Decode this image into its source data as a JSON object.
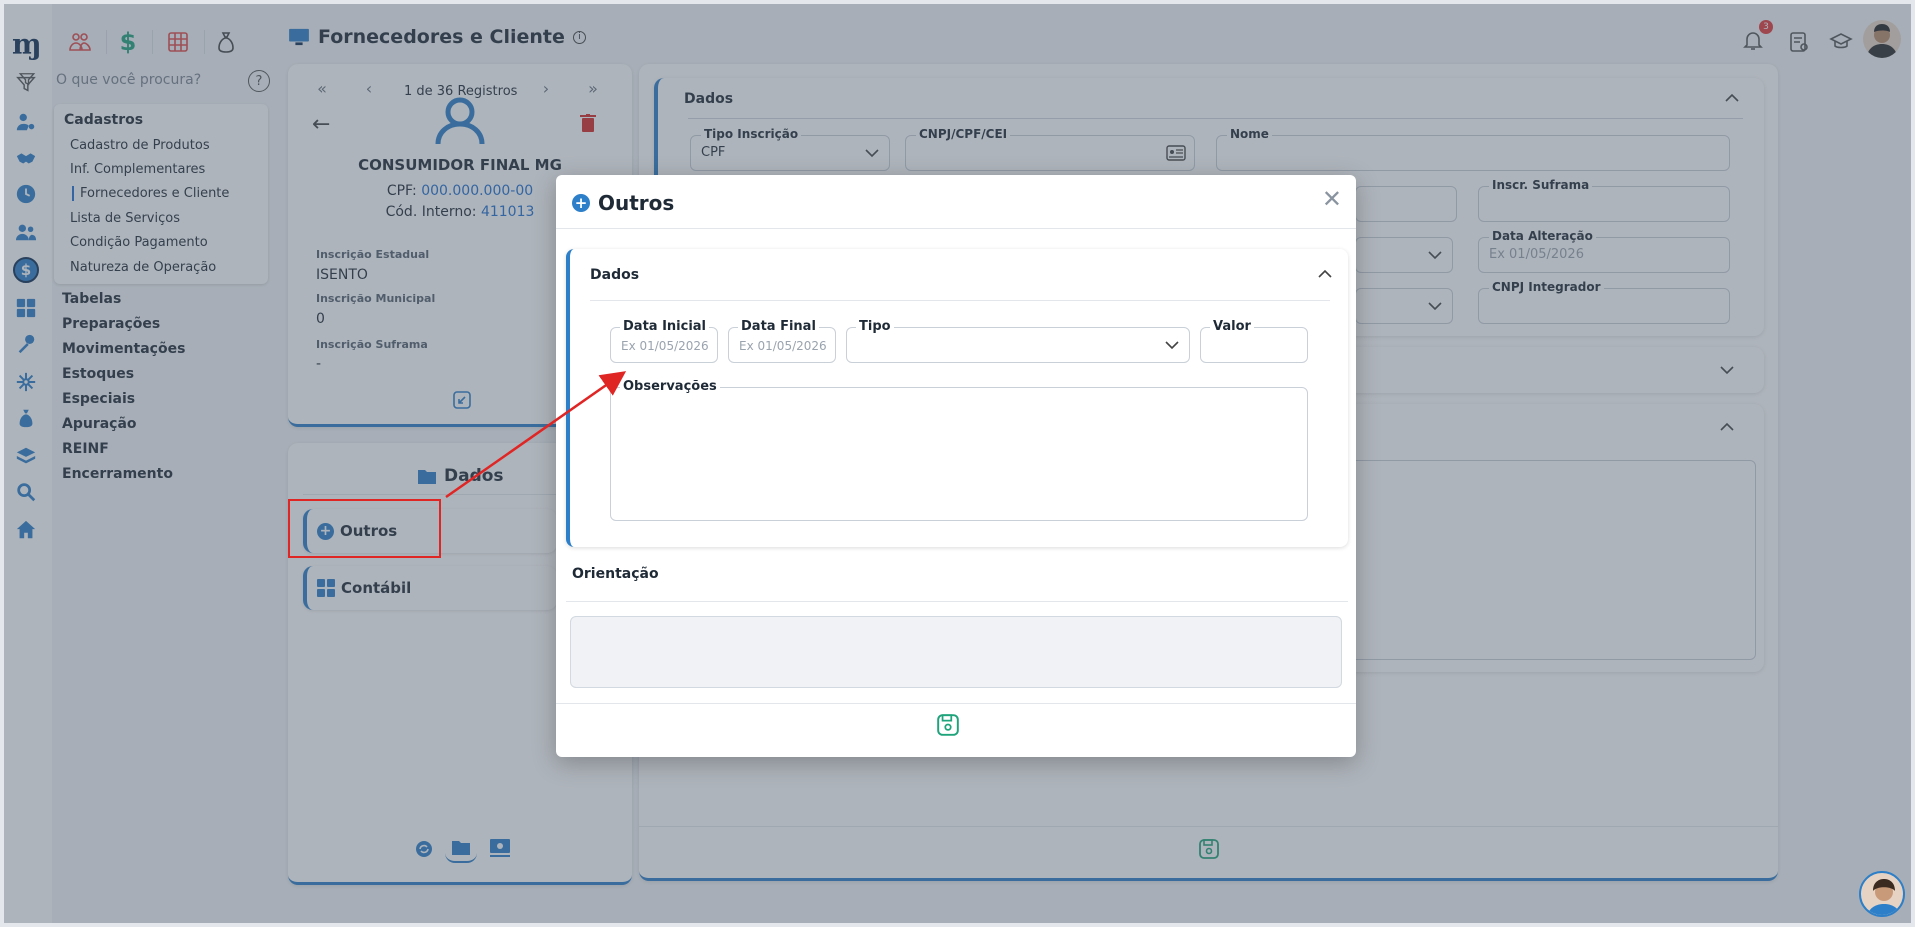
{
  "header": {
    "page_title": "Fornecedores e Cliente",
    "search_placeholder": "O que você procura?",
    "notification_count": "3"
  },
  "menu": {
    "group_title": "Cadastros",
    "items": [
      {
        "label": "Cadastro de Produtos"
      },
      {
        "label": "Inf. Complementares"
      },
      {
        "label": "Fornecedores e Cliente"
      },
      {
        "label": "Lista de Serviços"
      },
      {
        "label": "Condição Pagamento"
      },
      {
        "label": "Natureza de Operação"
      }
    ],
    "sections": [
      "Tabelas",
      "Preparações",
      "Movimentações",
      "Estoques",
      "Especiais",
      "Apuração",
      "REINF",
      "Encerramento"
    ]
  },
  "record": {
    "nav_text": "1 de 36 Registros",
    "name": "CONSUMIDOR FINAL MG",
    "cpf_label": "CPF:",
    "cpf_value": "000.000.000-00",
    "cod_label": "Cód. Interno:",
    "cod_value": "411013",
    "fields": [
      {
        "label": "Inscrição Estadual",
        "value": "ISENTO"
      },
      {
        "label": "Inscrição Municipal",
        "value": "0"
      },
      {
        "label": "Inscrição Suframa",
        "value": "-"
      }
    ]
  },
  "side_nav": {
    "title": "Dados",
    "tabs": [
      {
        "label": "Outros"
      },
      {
        "label": "Contábil"
      }
    ]
  },
  "main_form": {
    "section_title": "Dados",
    "fields": {
      "tipo_inscricao_label": "Tipo Inscrição",
      "tipo_inscricao_value": "CPF",
      "cnpj_label": "CNPJ/CPF/CEI",
      "nome_label": "Nome",
      "inscr_suframa_label": "Inscr. Suframa",
      "data_alteracao_label": "Data Alteração",
      "data_alteracao_placeholder": "Ex 01/05/2026",
      "cnpj_integrador_label": "CNPJ Integrador"
    }
  },
  "modal": {
    "title": "Outros",
    "section_title": "Dados",
    "fields": {
      "data_inicial_label": "Data Inicial",
      "data_inicial_placeholder": "Ex 01/05/2026",
      "data_final_label": "Data Final",
      "data_final_placeholder": "Ex 01/05/2026",
      "tipo_label": "Tipo",
      "valor_label": "Valor",
      "observacoes_label": "Observações"
    },
    "orientacao_title": "Orientação"
  },
  "colors": {
    "accent": "#2c7fc8",
    "highlight_box": "#e02525",
    "save_icon": "#1fa37a",
    "delete_icon": "#d62828"
  }
}
